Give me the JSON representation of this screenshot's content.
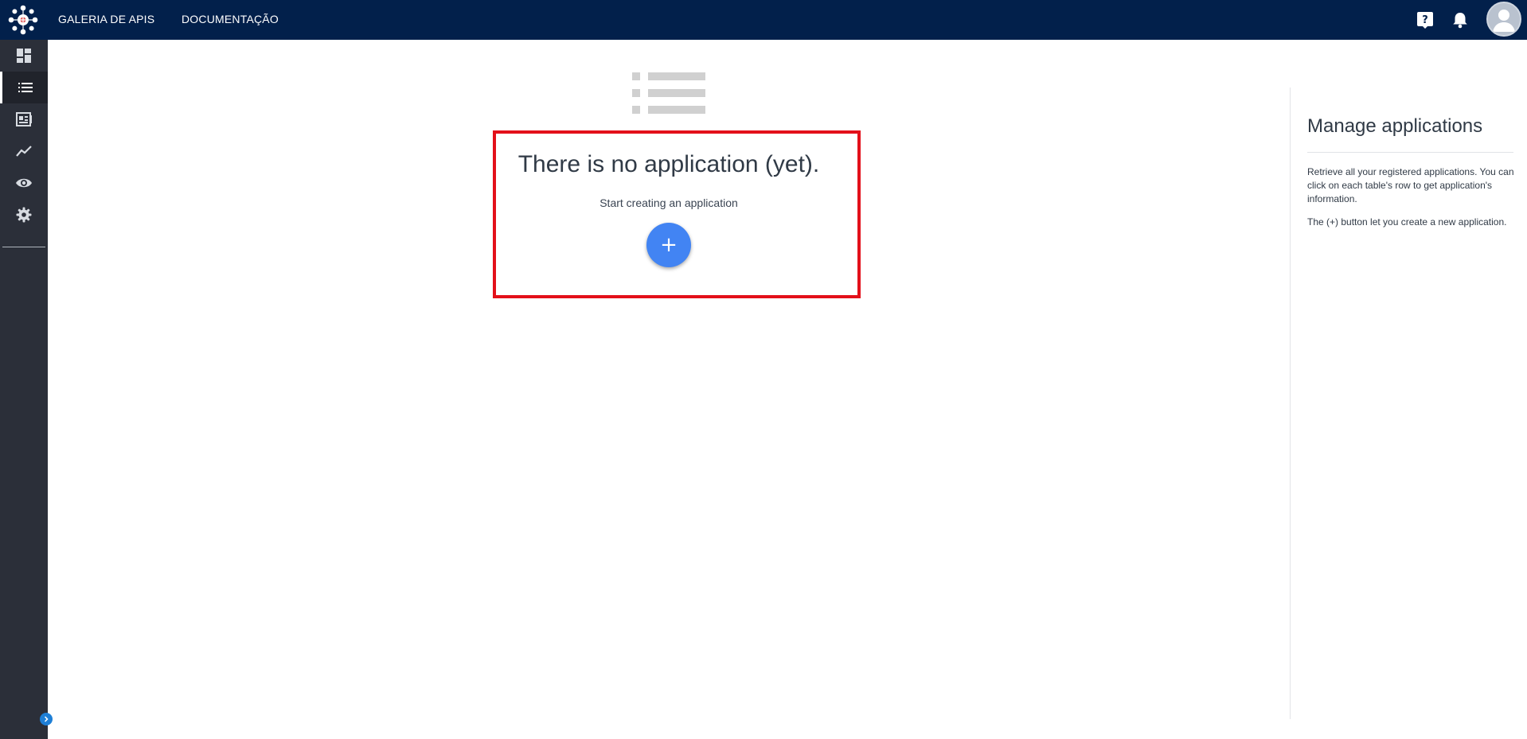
{
  "topbar": {
    "nav": [
      "GALERIA DE APIS",
      "DOCUMENTAÇÃO"
    ],
    "icons": [
      "help-icon",
      "notifications-icon",
      "account-icon"
    ],
    "background": "#02204b"
  },
  "sidebar": {
    "items": [
      {
        "icon": "dashboard-icon"
      },
      {
        "icon": "applications-list-icon",
        "active": true
      },
      {
        "icon": "catalog-icon"
      },
      {
        "icon": "analytics-icon"
      },
      {
        "icon": "audit-icon"
      },
      {
        "icon": "settings-icon"
      }
    ],
    "background": "#2b2f39"
  },
  "main": {
    "empty_title": "There is no application (yet).",
    "empty_subtitle": "Start creating an application",
    "add_button_label": "+",
    "accent": "#4284f3",
    "highlight_color": "#e3101a"
  },
  "help_panel": {
    "title": "Manage applications",
    "paragraph1": "Retrieve all your registered applications. You can click on each table's row to get application's information.",
    "paragraph2": "The (+) button let you create a new application."
  }
}
